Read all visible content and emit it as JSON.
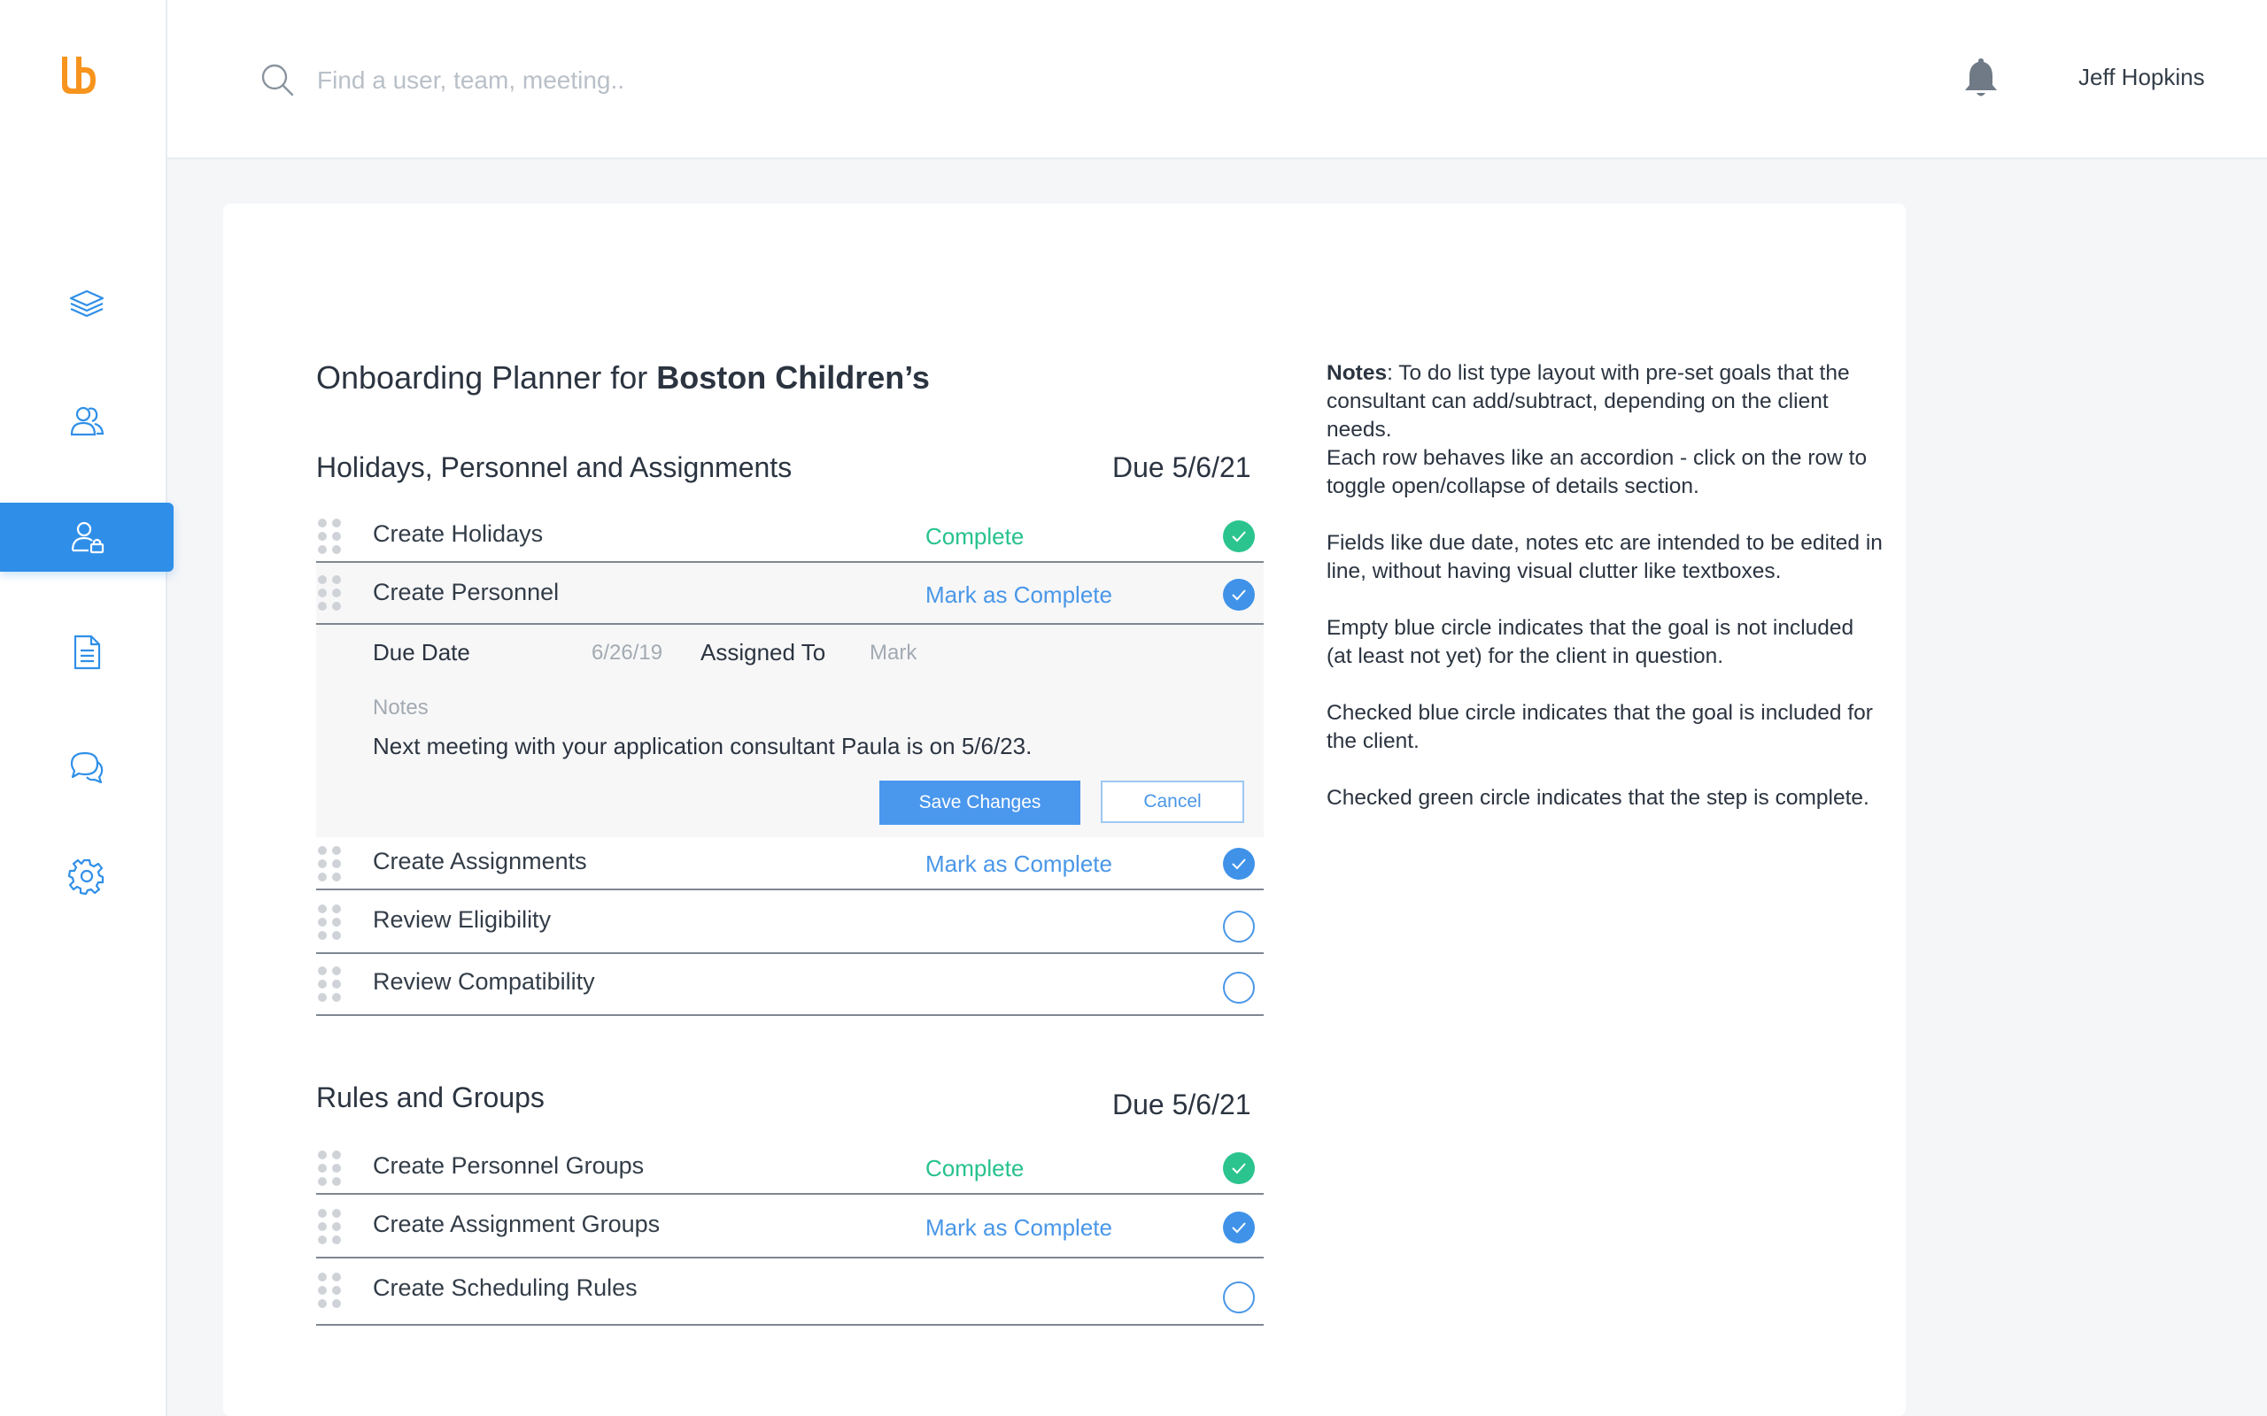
{
  "brand": {
    "logo_icon": "logo-icon",
    "accent_color": "#f7941d"
  },
  "sidebar": {
    "items": [
      {
        "name": "layers",
        "icon": "layers-icon",
        "active": false
      },
      {
        "name": "teams",
        "icon": "users-icon",
        "active": false
      },
      {
        "name": "user-admin",
        "icon": "user-lock-icon",
        "active": true
      },
      {
        "name": "documents",
        "icon": "document-icon",
        "active": false
      },
      {
        "name": "messages",
        "icon": "chat-icon",
        "active": false
      },
      {
        "name": "settings",
        "icon": "gear-icon",
        "active": false
      }
    ]
  },
  "header": {
    "search_placeholder": "Find a user, team, meeting..",
    "user_name": "Jeff Hopkins"
  },
  "planner": {
    "title_prefix": "Onboarding Planner for ",
    "title_client": "Boston Children’s",
    "sections": [
      {
        "title": "Holidays, Personnel and Assignments",
        "due": "Due 5/6/21",
        "rows": [
          {
            "label": "Create Holidays",
            "status": "Complete",
            "state": "complete"
          },
          {
            "label": "Create Personnel",
            "status": "Mark as Complete",
            "state": "included",
            "details": {
              "due_date_label": "Due Date",
              "due_date_value": "6/26/19",
              "assigned_label": "Assigned To",
              "assigned_value": "Mark",
              "notes_label": "Notes",
              "notes_text": "Next meeting with your application consultant Paula is on 5/6/23.",
              "save_label": "Save Changes",
              "cancel_label": "Cancel"
            }
          },
          {
            "label": "Create Assignments",
            "status": "Mark as Complete",
            "state": "included"
          },
          {
            "label": "Review Eligibility",
            "status": "",
            "state": "empty"
          },
          {
            "label": "Review Compatibility",
            "status": "",
            "state": "empty"
          }
        ]
      },
      {
        "title": "Rules and Groups",
        "due": "Due 5/6/21",
        "rows": [
          {
            "label": "Create Personnel Groups",
            "status": "Complete",
            "state": "complete"
          },
          {
            "label": "Create Assignment Groups",
            "status": "Mark as Complete",
            "state": "included"
          },
          {
            "label": "Create Scheduling Rules",
            "status": "",
            "state": "empty"
          }
        ]
      }
    ]
  },
  "notes": {
    "heading": "Notes",
    "p1": ": To do list type layout with pre-set goals that the consultant can add/subtract, depending on the client needs.",
    "p1b": "Each row behaves like an accordion - click on the row to toggle open/collapse of details section.",
    "p2": "Fields like due date, notes etc are intended to be edited in line, without having visual clutter like textboxes.",
    "p3": "Empty blue circle indicates that the goal is not included (at least not yet) for the client in question.",
    "p4": "Checked blue circle indicates that the goal is included for the client.",
    "p5": "Checked green circle indicates that the step is complete."
  },
  "colors": {
    "primary": "#2f8fe8",
    "complete": "#2bc48e",
    "included": "#3f92e8",
    "background": "#f5f6f8"
  }
}
